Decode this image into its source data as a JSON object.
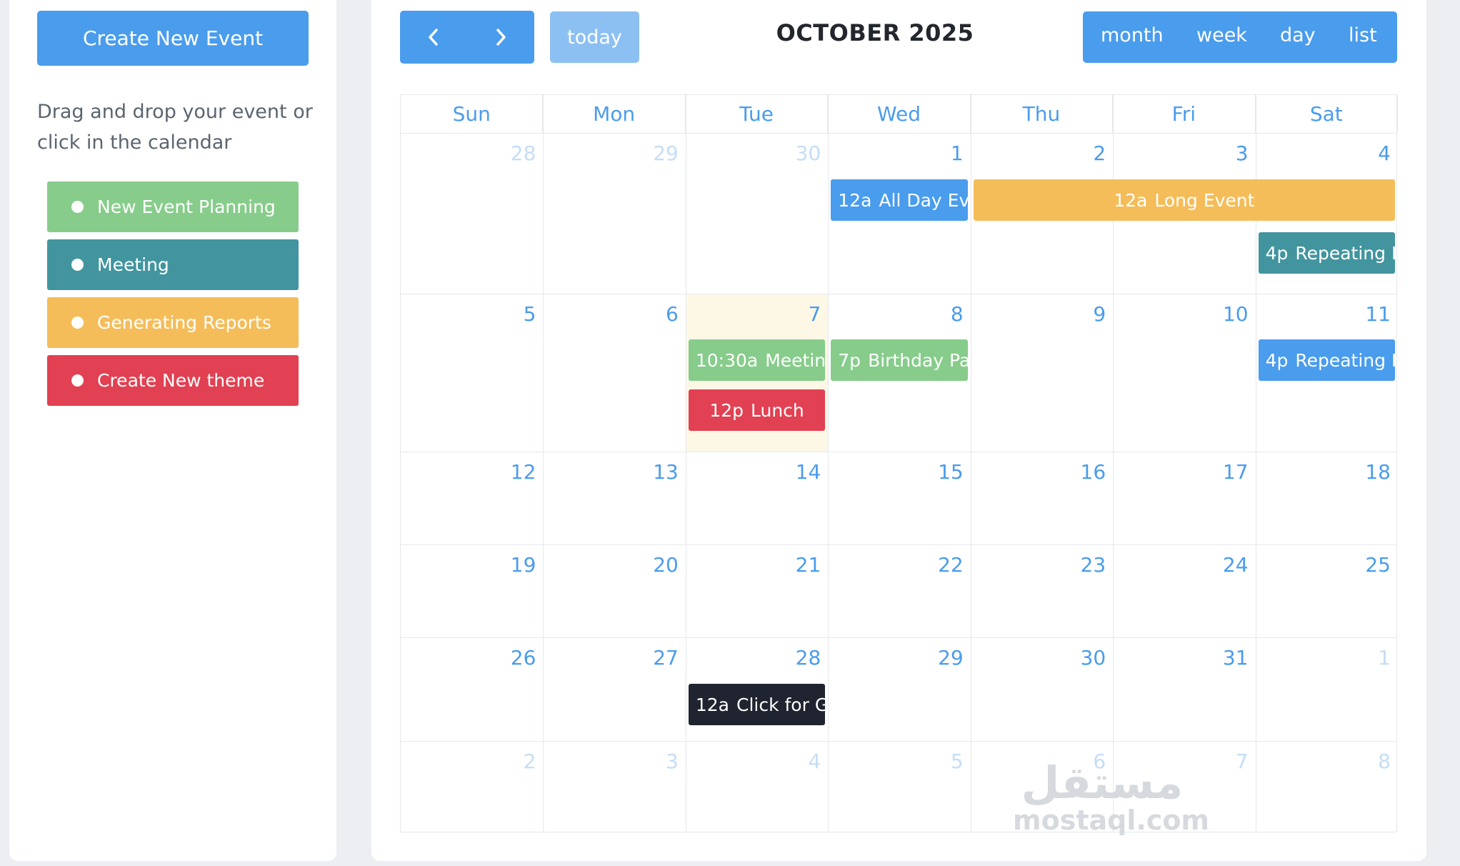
{
  "sidebar": {
    "create_button": "Create New Event",
    "instructions": "Drag and drop your event or click in the calendar",
    "external_events": [
      {
        "label": "New Event Planning",
        "color": "#87cc8b"
      },
      {
        "label": "Meeting",
        "color": "#42959f"
      },
      {
        "label": "Generating Reports",
        "color": "#f4bd5a"
      },
      {
        "label": "Create New theme",
        "color": "#e14152"
      }
    ]
  },
  "toolbar": {
    "prev_icon": "chevron-left-icon",
    "next_icon": "chevron-right-icon",
    "today_label": "today",
    "title": "OCTOBER 2025",
    "views": [
      "month",
      "week",
      "day",
      "list"
    ]
  },
  "calendar": {
    "weekdays": [
      "Sun",
      "Mon",
      "Tue",
      "Wed",
      "Thu",
      "Fri",
      "Sat"
    ],
    "weeks": [
      [
        {
          "d": "28",
          "other": true
        },
        {
          "d": "29",
          "other": true
        },
        {
          "d": "30",
          "other": true
        },
        {
          "d": "1"
        },
        {
          "d": "2"
        },
        {
          "d": "3"
        },
        {
          "d": "4"
        }
      ],
      [
        {
          "d": "5"
        },
        {
          "d": "6"
        },
        {
          "d": "7",
          "today": true
        },
        {
          "d": "8"
        },
        {
          "d": "9"
        },
        {
          "d": "10"
        },
        {
          "d": "11"
        }
      ],
      [
        {
          "d": "12"
        },
        {
          "d": "13"
        },
        {
          "d": "14"
        },
        {
          "d": "15"
        },
        {
          "d": "16"
        },
        {
          "d": "17"
        },
        {
          "d": "18"
        }
      ],
      [
        {
          "d": "19"
        },
        {
          "d": "20"
        },
        {
          "d": "21"
        },
        {
          "d": "22"
        },
        {
          "d": "23"
        },
        {
          "d": "24"
        },
        {
          "d": "25"
        }
      ],
      [
        {
          "d": "26"
        },
        {
          "d": "27"
        },
        {
          "d": "28"
        },
        {
          "d": "29"
        },
        {
          "d": "30"
        },
        {
          "d": "31"
        },
        {
          "d": "1",
          "other": true
        }
      ],
      [
        {
          "d": "2",
          "other": true
        },
        {
          "d": "3",
          "other": true
        },
        {
          "d": "4",
          "other": true
        },
        {
          "d": "5",
          "other": true
        },
        {
          "d": "6",
          "other": true
        },
        {
          "d": "7",
          "other": true
        },
        {
          "d": "8",
          "other": true
        }
      ]
    ],
    "events": [
      {
        "time": "12a",
        "title": "All Day Event",
        "color": "#4a9cec"
      },
      {
        "time": "12a",
        "title": "Long Event",
        "color": "#f4bd5a"
      },
      {
        "time": "4p",
        "title": "Repeating Event",
        "color": "#42959f"
      },
      {
        "time": "10:30a",
        "title": "Meeting",
        "color": "#87cc8b"
      },
      {
        "time": "12p",
        "title": "Lunch",
        "color": "#e14152"
      },
      {
        "time": "7p",
        "title": "Birthday Party",
        "color": "#87cc8b"
      },
      {
        "time": "4p",
        "title": "Repeating Event",
        "color": "#4a9cec"
      },
      {
        "time": "12a",
        "title": "Click for Google",
        "color": "#1f2430"
      }
    ]
  },
  "watermark": {
    "arabic": "مستقل",
    "latin": "mostaql.com"
  }
}
